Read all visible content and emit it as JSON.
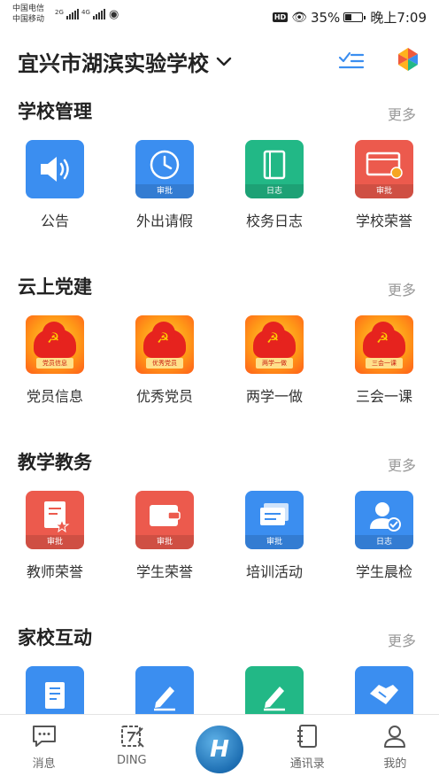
{
  "status_bar": {
    "carrier1": "中国电信",
    "carrier2": "中国移动",
    "net1": "2G",
    "net2": "4G",
    "battery": "35%",
    "time": "晚上7:09"
  },
  "header": {
    "school_name": "宜兴市湖滨实验学校"
  },
  "sections": [
    {
      "title": "学校管理",
      "more": "更多",
      "items": [
        {
          "label": "公告",
          "tag": "",
          "icon": "megaphone-icon",
          "color": "#3b8ef0"
        },
        {
          "label": "外出请假",
          "tag": "审批",
          "icon": "clock-icon",
          "color": "#3b8ef0"
        },
        {
          "label": "校务日志",
          "tag": "日志",
          "icon": "notebook-icon",
          "color": "#22b886"
        },
        {
          "label": "学校荣誉",
          "tag": "审批",
          "icon": "certificate-icon",
          "color": "#ec5a4d"
        }
      ]
    },
    {
      "title": "云上党建",
      "more": "更多",
      "items": [
        {
          "label": "党员信息",
          "tag": "党员信息",
          "icon": "party-emblem-icon",
          "color": "#ff9a17"
        },
        {
          "label": "优秀党员",
          "tag": "优秀党员",
          "icon": "party-emblem-icon",
          "color": "#ff9a17"
        },
        {
          "label": "两学一做",
          "tag": "两学一做",
          "icon": "party-emblem-icon",
          "color": "#ff9a17"
        },
        {
          "label": "三会一课",
          "tag": "三会一课",
          "icon": "party-emblem-icon",
          "color": "#ff9a17"
        }
      ]
    },
    {
      "title": "教学教务",
      "more": "更多",
      "items": [
        {
          "label": "教师荣誉",
          "tag": "审批",
          "icon": "document-star-icon",
          "color": "#ec5a4d"
        },
        {
          "label": "学生荣誉",
          "tag": "审批",
          "icon": "wallet-icon",
          "color": "#ec5a4d"
        },
        {
          "label": "培训活动",
          "tag": "审批",
          "icon": "cards-icon",
          "color": "#3b8ef0"
        },
        {
          "label": "学生晨检",
          "tag": "日志",
          "icon": "person-check-icon",
          "color": "#3b8ef0"
        }
      ]
    },
    {
      "title": "家校互动",
      "more": "更多",
      "items": [
        {
          "label": "",
          "tag": "",
          "icon": "list-document-icon",
          "color": "#3b8ef0"
        },
        {
          "label": "",
          "tag": "",
          "icon": "pencil-icon",
          "color": "#3b8ef0"
        },
        {
          "label": "",
          "tag": "",
          "icon": "pencil-icon",
          "color": "#22b886"
        },
        {
          "label": "",
          "tag": "",
          "icon": "handshake-icon",
          "color": "#3b8ef0"
        }
      ]
    }
  ],
  "tabbar": {
    "messages": "消息",
    "ding": "DING",
    "contacts": "通讯录",
    "me": "我的"
  }
}
